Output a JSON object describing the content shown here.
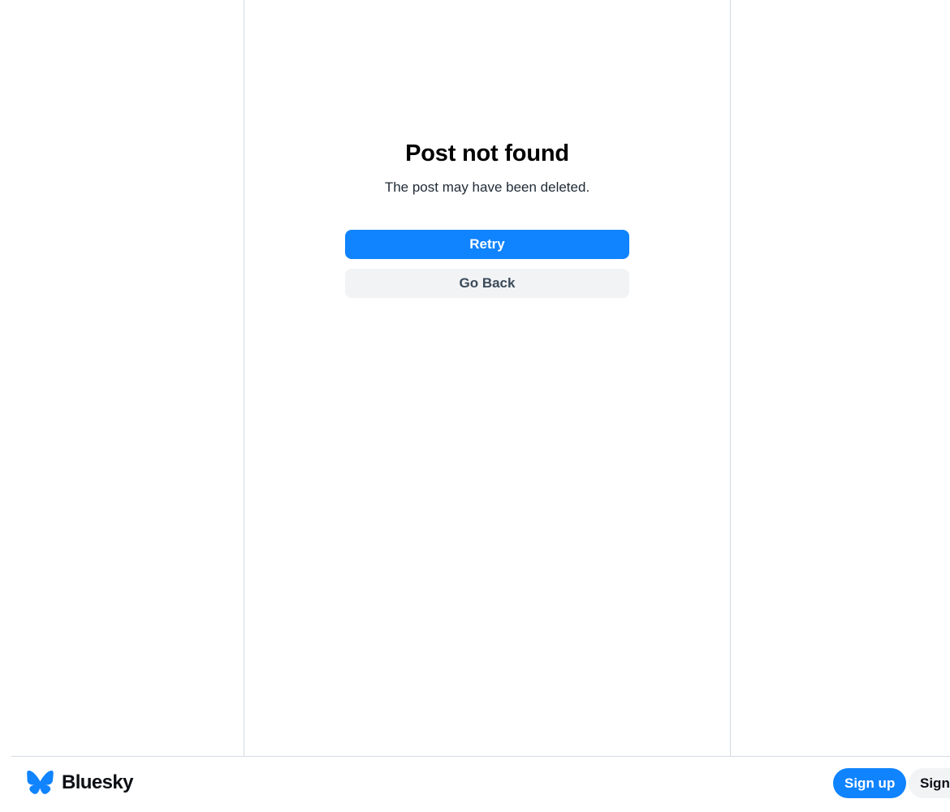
{
  "error": {
    "title": "Post not found",
    "subtitle": "The post may have been deleted.",
    "retry_label": "Retry",
    "back_label": "Go Back"
  },
  "footer": {
    "brand_name": "Bluesky",
    "logo_icon": "butterfly-icon",
    "signup_label": "Sign up",
    "signin_label": "Sign in"
  },
  "colors": {
    "accent": "#1083fe",
    "secondary_button": "#f1f3f5",
    "border": "#d4dbe2"
  }
}
